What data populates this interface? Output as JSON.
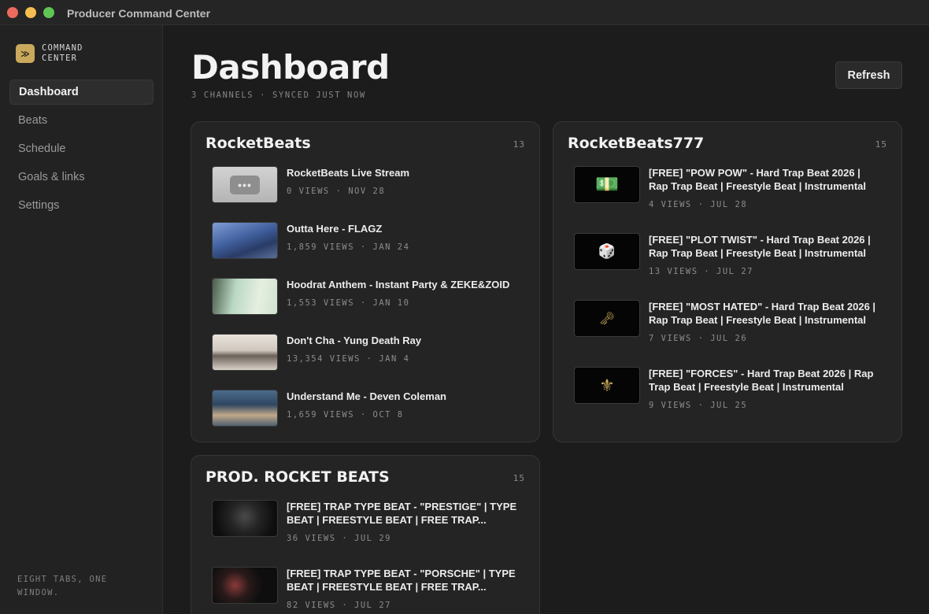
{
  "window": {
    "title": "Producer Command Center"
  },
  "brand": {
    "logo_glyph": "≫",
    "name": "COMMAND CENTER",
    "accent": "#c9a95c"
  },
  "nav": [
    {
      "label": "Dashboard",
      "active": true
    },
    {
      "label": "Beats",
      "active": false
    },
    {
      "label": "Schedule",
      "active": false
    },
    {
      "label": "Goals & links",
      "active": false
    },
    {
      "label": "Settings",
      "active": false
    }
  ],
  "sidebar_footer": "EIGHT TABS, ONE WINDOW.",
  "header": {
    "title": "Dashboard",
    "subtitle": "3 CHANNELS · SYNCED JUST NOW",
    "refresh_label": "Refresh"
  },
  "channels": [
    {
      "name": "RocketBeats",
      "count": "13",
      "videos": [
        {
          "title": "RocketBeats Live Stream",
          "meta": "0 VIEWS · NOV 28",
          "thumb": "live-stream-placeholder",
          "thumb_glyph": "•••"
        },
        {
          "title": "Outta Here - FLAGZ",
          "meta": "1,859 VIEWS · JAN 24",
          "thumb": "street-photo"
        },
        {
          "title": "Hoodrat Anthem - Instant Party & ZEKE&ZOID",
          "meta": "1,553 VIEWS · JAN 10",
          "thumb": "girl-portrait"
        },
        {
          "title": "Don't Cha - Yung Death Ray",
          "meta": "13,354 VIEWS · JAN 4",
          "thumb": "girl-street"
        },
        {
          "title": "Understand Me - Deven Coleman",
          "meta": "1,659 VIEWS · OCT 8",
          "thumb": "bathtub-photo"
        }
      ]
    },
    {
      "name": "RocketBeats777",
      "count": "15",
      "videos": [
        {
          "title": "[FREE] \"POW POW\" - Hard Trap Beat 2026 | Rap Trap Beat | Freestyle Beat | Instrumental",
          "meta": "4 VIEWS · JUL 28",
          "thumb": "burning-money-icon",
          "thumb_glyph": "💵"
        },
        {
          "title": "[FREE] \"PLOT TWIST\" - Hard Trap Beat 2026 | Rap Trap Beat | Freestyle Beat | Instrumental",
          "meta": "13 VIEWS · JUL 27",
          "thumb": "dice-icon",
          "thumb_glyph": "🎲"
        },
        {
          "title": "[FREE] \"MOST HATED\" - Hard Trap Beat 2026 | Rap Trap Beat | Freestyle Beat | Instrumental",
          "meta": "7 VIEWS · JUL 26",
          "thumb": "key-icon",
          "thumb_glyph": "🗝"
        },
        {
          "title": "[FREE] \"FORCES\" - Hard Trap Beat 2026 | Rap Trap Beat | Freestyle Beat | Instrumental",
          "meta": "9 VIEWS · JUL 25",
          "thumb": "gold-drip-icon",
          "thumb_glyph": "⚜"
        }
      ]
    },
    {
      "name": "PROD. ROCKET BEATS",
      "count": "15",
      "videos": [
        {
          "title": "[FREE] TRAP TYPE BEAT - \"PRESTIGE\" | TYPE BEAT | FREESTYLE BEAT | FREE TRAP...",
          "meta": "36 VIEWS · JUL 29",
          "thumb": "masked-figure"
        },
        {
          "title": "[FREE] TRAP TYPE BEAT - \"PORSCHE\" | TYPE BEAT | FREESTYLE BEAT | FREE TRAP...",
          "meta": "82 VIEWS · JUL 27",
          "thumb": "masked-figure-red"
        }
      ]
    }
  ]
}
